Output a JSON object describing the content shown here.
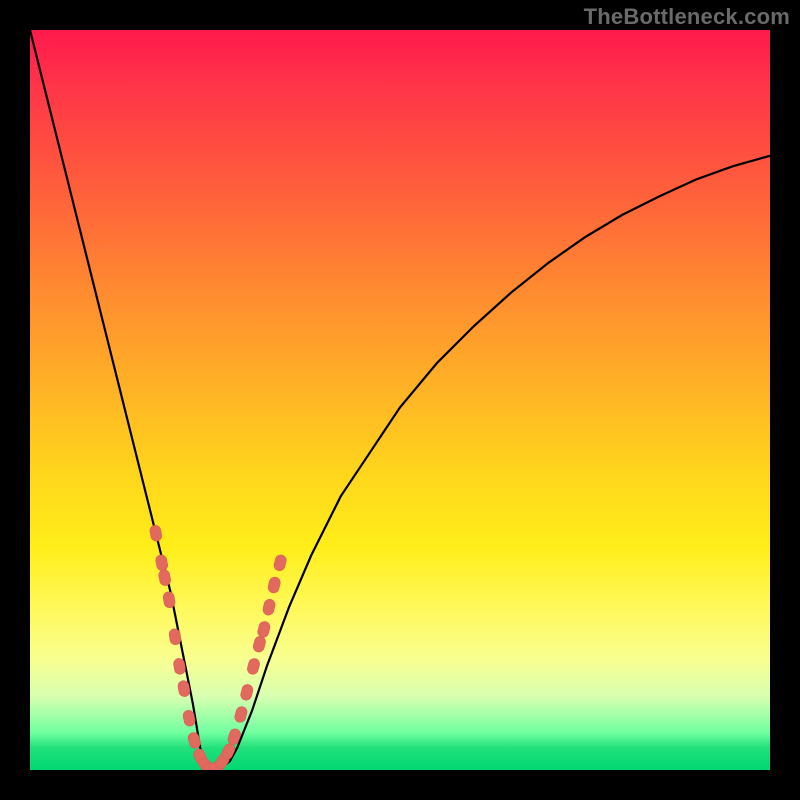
{
  "watermark": "TheBottleneck.com",
  "colors": {
    "page_bg": "#000000",
    "gradient_top": "#ff1a4d",
    "gradient_bottom": "#00d873",
    "curve": "#000000",
    "marker_fill": "#e2695e",
    "marker_stroke": "#d85a50"
  },
  "chart_data": {
    "type": "line",
    "title": "",
    "xlabel": "",
    "ylabel": "",
    "xlim": [
      0,
      100
    ],
    "ylim": [
      0,
      100
    ],
    "x": [
      0,
      2,
      4,
      6,
      8,
      10,
      12,
      14,
      16,
      17,
      18,
      19,
      20,
      21,
      22,
      22.5,
      23,
      23.5,
      24,
      25,
      26,
      27,
      28,
      30,
      32,
      35,
      38,
      42,
      46,
      50,
      55,
      60,
      65,
      70,
      75,
      80,
      85,
      90,
      95,
      100
    ],
    "values": [
      100,
      92,
      84,
      76,
      68,
      60,
      52,
      44,
      36,
      32,
      28,
      24,
      19,
      14,
      9,
      6,
      3,
      1.2,
      0.4,
      0.2,
      0.4,
      1.2,
      3,
      8,
      14,
      22,
      29,
      37,
      43,
      49,
      55,
      60,
      64.5,
      68.5,
      72,
      75,
      77.5,
      79.8,
      81.6,
      83
    ],
    "series_name": "bottleneck-curve",
    "minimum_at_x": 24.5,
    "markers": [
      {
        "x": 17.0,
        "y": 32
      },
      {
        "x": 17.8,
        "y": 28
      },
      {
        "x": 18.2,
        "y": 26
      },
      {
        "x": 18.8,
        "y": 23
      },
      {
        "x": 19.6,
        "y": 18
      },
      {
        "x": 20.2,
        "y": 14
      },
      {
        "x": 20.8,
        "y": 11
      },
      {
        "x": 21.5,
        "y": 7
      },
      {
        "x": 22.2,
        "y": 4
      },
      {
        "x": 23.0,
        "y": 1.8
      },
      {
        "x": 23.8,
        "y": 0.6
      },
      {
        "x": 24.5,
        "y": 0.2
      },
      {
        "x": 25.3,
        "y": 0.4
      },
      {
        "x": 26.0,
        "y": 1.2
      },
      {
        "x": 26.8,
        "y": 2.5
      },
      {
        "x": 27.6,
        "y": 4.5
      },
      {
        "x": 28.5,
        "y": 7.5
      },
      {
        "x": 29.3,
        "y": 10.5
      },
      {
        "x": 30.2,
        "y": 14
      },
      {
        "x": 31.0,
        "y": 17
      },
      {
        "x": 31.6,
        "y": 19
      },
      {
        "x": 32.3,
        "y": 22
      },
      {
        "x": 33.0,
        "y": 25
      },
      {
        "x": 33.8,
        "y": 28
      }
    ]
  }
}
